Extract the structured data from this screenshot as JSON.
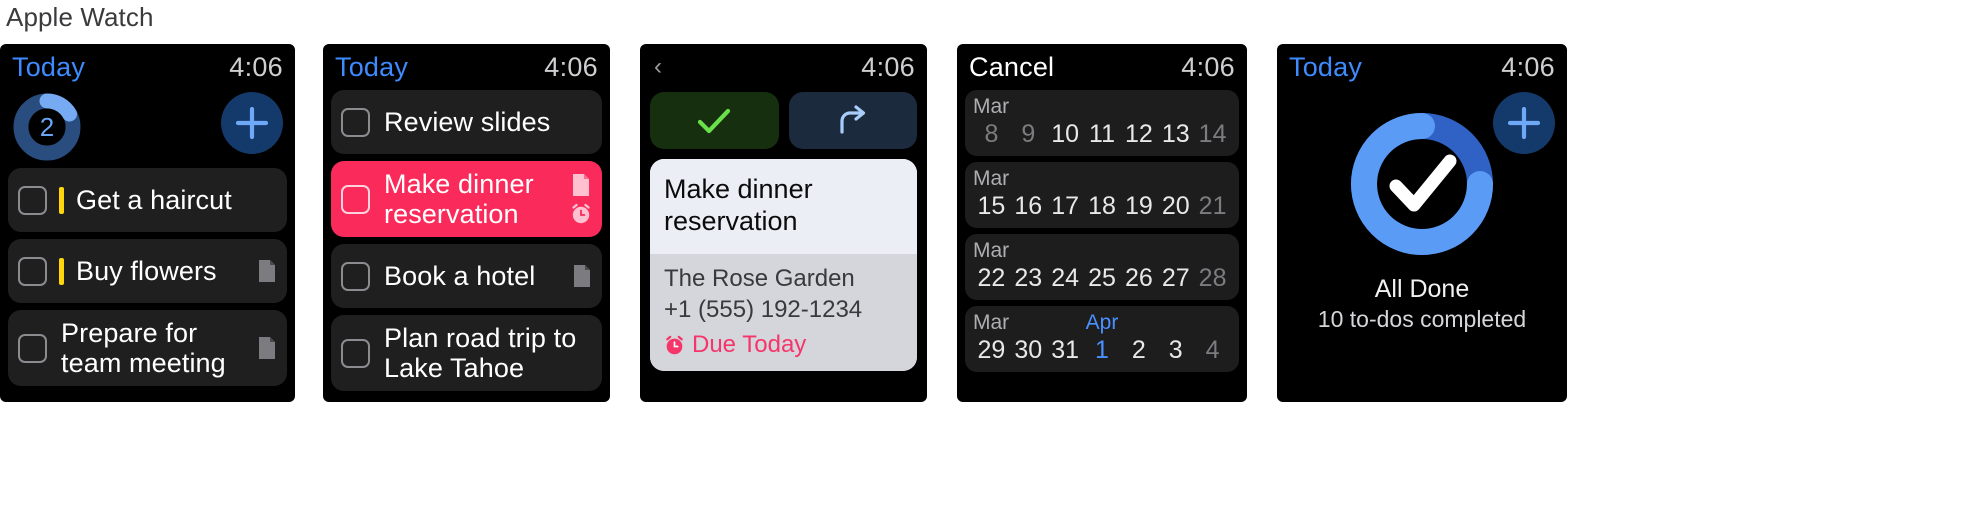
{
  "caption": "Apple Watch",
  "panels": [
    {
      "id": "today-list",
      "status": {
        "left_label": "Today",
        "time": "4:06"
      },
      "progress": {
        "count": "2",
        "ring_fraction": 0.3
      },
      "add_button_icon": "plus-icon",
      "items": [
        {
          "title": "Get a haircut",
          "priority": true,
          "note": false
        },
        {
          "title": "Buy flowers",
          "priority": true,
          "note": true
        },
        {
          "title": "Prepare for team meeting",
          "priority": false,
          "note": true
        }
      ]
    },
    {
      "id": "task-list",
      "status": {
        "left_label": "Today",
        "time": "4:06"
      },
      "items": [
        {
          "title": "Review slides",
          "highlighted": false,
          "note": false,
          "alarm": false
        },
        {
          "title": "Make dinner reservation",
          "highlighted": true,
          "note": true,
          "alarm": true
        },
        {
          "title": "Book a hotel",
          "highlighted": false,
          "note": true,
          "alarm": false
        },
        {
          "title": "Plan road trip to Lake Tahoe",
          "highlighted": false,
          "note": false,
          "alarm": false
        }
      ]
    },
    {
      "id": "task-detail",
      "status": {
        "back_icon": "chevron-left-icon",
        "time": "4:06"
      },
      "actions": [
        {
          "name": "complete",
          "icon": "checkmark-icon",
          "color": "#6ae04a"
        },
        {
          "name": "snooze",
          "icon": "arrow-turn-right-icon",
          "color": "#a9cdfb"
        }
      ],
      "card": {
        "title": "Make dinner reservation",
        "place": "The Rose Garden",
        "phone": "+1 (555) 192-1234",
        "due_label": "Due Today",
        "due_icon": "alarm-clock-icon",
        "due_color": "#f6356a"
      }
    },
    {
      "id": "date-picker",
      "status": {
        "left_label": "Cancel",
        "time": "4:06"
      },
      "weeks": [
        {
          "months": [
            {
              "label": "Mar",
              "accent": false
            }
          ],
          "days": [
            {
              "d": "8",
              "accent": false,
              "dim": true
            },
            {
              "d": "9",
              "accent": false,
              "dim": true
            },
            {
              "d": "10",
              "accent": false,
              "dim": false
            },
            {
              "d": "11",
              "accent": false,
              "dim": false
            },
            {
              "d": "12",
              "accent": false,
              "dim": false
            },
            {
              "d": "13",
              "accent": false,
              "dim": false
            },
            {
              "d": "14",
              "accent": false,
              "dim": true
            }
          ]
        },
        {
          "months": [
            {
              "label": "Mar",
              "accent": false
            }
          ],
          "days": [
            {
              "d": "15",
              "accent": false,
              "dim": false
            },
            {
              "d": "16",
              "accent": false,
              "dim": false
            },
            {
              "d": "17",
              "accent": false,
              "dim": false
            },
            {
              "d": "18",
              "accent": false,
              "dim": false
            },
            {
              "d": "19",
              "accent": false,
              "dim": false
            },
            {
              "d": "20",
              "accent": false,
              "dim": false
            },
            {
              "d": "21",
              "accent": false,
              "dim": true
            }
          ]
        },
        {
          "months": [
            {
              "label": "Mar",
              "accent": false
            }
          ],
          "days": [
            {
              "d": "22",
              "accent": false,
              "dim": false
            },
            {
              "d": "23",
              "accent": false,
              "dim": false
            },
            {
              "d": "24",
              "accent": false,
              "dim": false
            },
            {
              "d": "25",
              "accent": false,
              "dim": false
            },
            {
              "d": "26",
              "accent": false,
              "dim": false
            },
            {
              "d": "27",
              "accent": false,
              "dim": false
            },
            {
              "d": "28",
              "accent": false,
              "dim": true
            }
          ]
        },
        {
          "months": [
            {
              "label": "Mar",
              "accent": false
            },
            {
              "label": "Apr",
              "accent": true
            }
          ],
          "days": [
            {
              "d": "29",
              "accent": false,
              "dim": false
            },
            {
              "d": "30",
              "accent": false,
              "dim": false
            },
            {
              "d": "31",
              "accent": false,
              "dim": false
            },
            {
              "d": "1",
              "accent": true,
              "dim": false
            },
            {
              "d": "2",
              "accent": false,
              "dim": false
            },
            {
              "d": "3",
              "accent": false,
              "dim": false
            },
            {
              "d": "4",
              "accent": false,
              "dim": true
            }
          ]
        }
      ]
    },
    {
      "id": "all-done",
      "status": {
        "left_label": "Today",
        "time": "4:06"
      },
      "add_button_icon": "plus-icon",
      "ring_icon": "checkmark-icon",
      "heading": "All Done",
      "subheading": "10 to-dos completed"
    }
  ],
  "colors": {
    "accent_blue": "#3d8bff",
    "ring_light": "#5a9bf6",
    "ring_dark": "#2a5fb5",
    "pink": "#fa2a5a",
    "yellow": "#ffd60a",
    "green": "#6ae04a",
    "screen_black": "#000000",
    "row_gray": "#1f1f1f"
  }
}
